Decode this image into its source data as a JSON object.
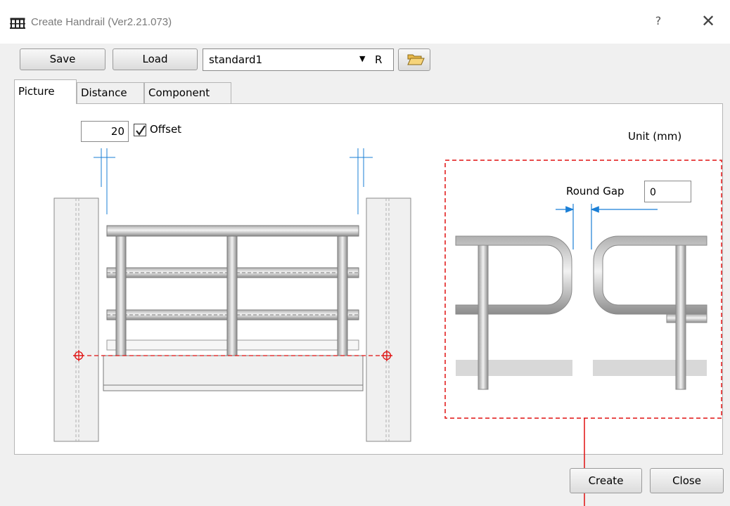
{
  "window": {
    "title": "Create Handrail (Ver2.21.073)",
    "help": "?",
    "close": "✕"
  },
  "toolbar": {
    "save_label": "Save",
    "load_label": "Load",
    "preset_value": "standard1",
    "preset_arrow": "▼",
    "preset_suffix": "R",
    "folder_icon": "folder-open-icon"
  },
  "tabs": [
    {
      "label": "Picture",
      "active": true
    },
    {
      "label": "Distance",
      "active": false
    },
    {
      "label": "Component",
      "active": false
    }
  ],
  "picture": {
    "offset_value": "20",
    "offset_label": "Offset",
    "offset_checked": true,
    "unit_label": "Unit (mm)",
    "round_gap_label": "Round Gap",
    "round_gap_value": "0"
  },
  "footer": {
    "create_label": "Create",
    "close_label": "Close"
  },
  "colors": {
    "dimension": "#1a7fd6",
    "highlight": "#e01010"
  }
}
